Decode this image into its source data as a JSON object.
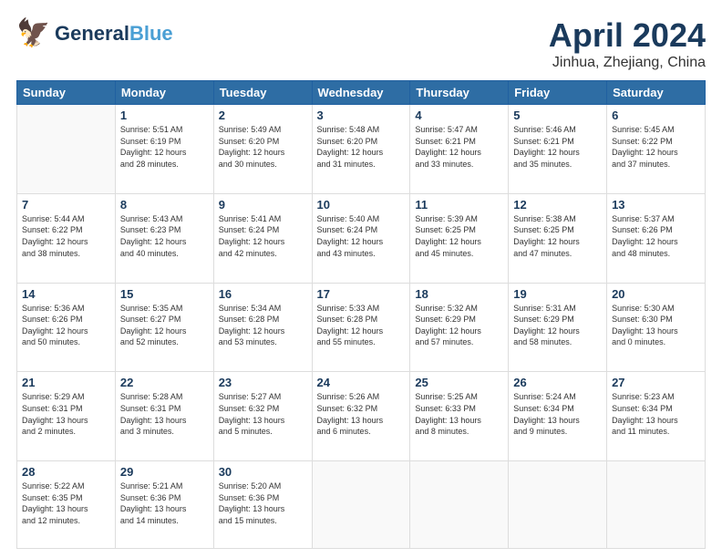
{
  "header": {
    "logo_line1": "General",
    "logo_line2": "Blue",
    "title": "April 2024",
    "subtitle": "Jinhua, Zhejiang, China"
  },
  "weekdays": [
    "Sunday",
    "Monday",
    "Tuesday",
    "Wednesday",
    "Thursday",
    "Friday",
    "Saturday"
  ],
  "weeks": [
    [
      {
        "day": "",
        "info": ""
      },
      {
        "day": "1",
        "info": "Sunrise: 5:51 AM\nSunset: 6:19 PM\nDaylight: 12 hours\nand 28 minutes."
      },
      {
        "day": "2",
        "info": "Sunrise: 5:49 AM\nSunset: 6:20 PM\nDaylight: 12 hours\nand 30 minutes."
      },
      {
        "day": "3",
        "info": "Sunrise: 5:48 AM\nSunset: 6:20 PM\nDaylight: 12 hours\nand 31 minutes."
      },
      {
        "day": "4",
        "info": "Sunrise: 5:47 AM\nSunset: 6:21 PM\nDaylight: 12 hours\nand 33 minutes."
      },
      {
        "day": "5",
        "info": "Sunrise: 5:46 AM\nSunset: 6:21 PM\nDaylight: 12 hours\nand 35 minutes."
      },
      {
        "day": "6",
        "info": "Sunrise: 5:45 AM\nSunset: 6:22 PM\nDaylight: 12 hours\nand 37 minutes."
      }
    ],
    [
      {
        "day": "7",
        "info": "Sunrise: 5:44 AM\nSunset: 6:22 PM\nDaylight: 12 hours\nand 38 minutes."
      },
      {
        "day": "8",
        "info": "Sunrise: 5:43 AM\nSunset: 6:23 PM\nDaylight: 12 hours\nand 40 minutes."
      },
      {
        "day": "9",
        "info": "Sunrise: 5:41 AM\nSunset: 6:24 PM\nDaylight: 12 hours\nand 42 minutes."
      },
      {
        "day": "10",
        "info": "Sunrise: 5:40 AM\nSunset: 6:24 PM\nDaylight: 12 hours\nand 43 minutes."
      },
      {
        "day": "11",
        "info": "Sunrise: 5:39 AM\nSunset: 6:25 PM\nDaylight: 12 hours\nand 45 minutes."
      },
      {
        "day": "12",
        "info": "Sunrise: 5:38 AM\nSunset: 6:25 PM\nDaylight: 12 hours\nand 47 minutes."
      },
      {
        "day": "13",
        "info": "Sunrise: 5:37 AM\nSunset: 6:26 PM\nDaylight: 12 hours\nand 48 minutes."
      }
    ],
    [
      {
        "day": "14",
        "info": "Sunrise: 5:36 AM\nSunset: 6:26 PM\nDaylight: 12 hours\nand 50 minutes."
      },
      {
        "day": "15",
        "info": "Sunrise: 5:35 AM\nSunset: 6:27 PM\nDaylight: 12 hours\nand 52 minutes."
      },
      {
        "day": "16",
        "info": "Sunrise: 5:34 AM\nSunset: 6:28 PM\nDaylight: 12 hours\nand 53 minutes."
      },
      {
        "day": "17",
        "info": "Sunrise: 5:33 AM\nSunset: 6:28 PM\nDaylight: 12 hours\nand 55 minutes."
      },
      {
        "day": "18",
        "info": "Sunrise: 5:32 AM\nSunset: 6:29 PM\nDaylight: 12 hours\nand 57 minutes."
      },
      {
        "day": "19",
        "info": "Sunrise: 5:31 AM\nSunset: 6:29 PM\nDaylight: 12 hours\nand 58 minutes."
      },
      {
        "day": "20",
        "info": "Sunrise: 5:30 AM\nSunset: 6:30 PM\nDaylight: 13 hours\nand 0 minutes."
      }
    ],
    [
      {
        "day": "21",
        "info": "Sunrise: 5:29 AM\nSunset: 6:31 PM\nDaylight: 13 hours\nand 2 minutes."
      },
      {
        "day": "22",
        "info": "Sunrise: 5:28 AM\nSunset: 6:31 PM\nDaylight: 13 hours\nand 3 minutes."
      },
      {
        "day": "23",
        "info": "Sunrise: 5:27 AM\nSunset: 6:32 PM\nDaylight: 13 hours\nand 5 minutes."
      },
      {
        "day": "24",
        "info": "Sunrise: 5:26 AM\nSunset: 6:32 PM\nDaylight: 13 hours\nand 6 minutes."
      },
      {
        "day": "25",
        "info": "Sunrise: 5:25 AM\nSunset: 6:33 PM\nDaylight: 13 hours\nand 8 minutes."
      },
      {
        "day": "26",
        "info": "Sunrise: 5:24 AM\nSunset: 6:34 PM\nDaylight: 13 hours\nand 9 minutes."
      },
      {
        "day": "27",
        "info": "Sunrise: 5:23 AM\nSunset: 6:34 PM\nDaylight: 13 hours\nand 11 minutes."
      }
    ],
    [
      {
        "day": "28",
        "info": "Sunrise: 5:22 AM\nSunset: 6:35 PM\nDaylight: 13 hours\nand 12 minutes."
      },
      {
        "day": "29",
        "info": "Sunrise: 5:21 AM\nSunset: 6:36 PM\nDaylight: 13 hours\nand 14 minutes."
      },
      {
        "day": "30",
        "info": "Sunrise: 5:20 AM\nSunset: 6:36 PM\nDaylight: 13 hours\nand 15 minutes."
      },
      {
        "day": "",
        "info": ""
      },
      {
        "day": "",
        "info": ""
      },
      {
        "day": "",
        "info": ""
      },
      {
        "day": "",
        "info": ""
      }
    ]
  ]
}
